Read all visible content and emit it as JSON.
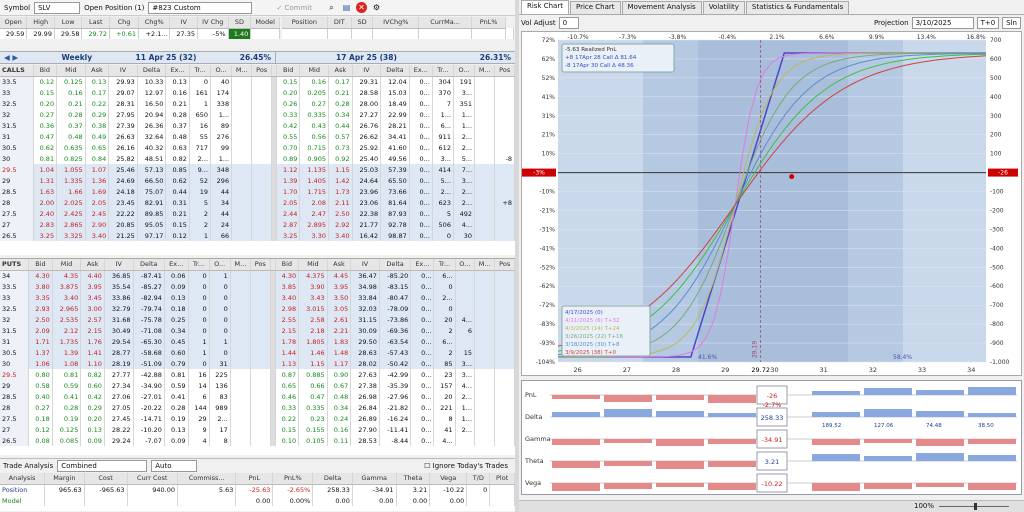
{
  "toolbar": {
    "symbol_label": "Symbol",
    "symbol_value": "SLV",
    "open_position_label": "Open Position (1)",
    "position_value": "#823 Custom",
    "commit_label": "Commit"
  },
  "quote": {
    "headers": [
      "Open",
      "High",
      "Low",
      "Last",
      "Chg",
      "Chg%",
      "IV",
      "IV Chg",
      "SD",
      "Model",
      "Position",
      "DIT",
      "SD",
      "IVChg%",
      "CurrMa...",
      "PnL%"
    ],
    "values": [
      "29.59",
      "29.99",
      "29.58",
      "29.72",
      "+0.61",
      "+2.1...",
      "27.35",
      "-5%",
      "1.40"
    ]
  },
  "weekly": {
    "left_label": "Weekly",
    "left_title": "11 Apr 25 (32)",
    "left_iv": "26.45%",
    "right_title": "17 Apr 25 (38)",
    "right_iv": "26.31%"
  },
  "calls_label": "CALLS",
  "puts_label": "PUTS",
  "left_cols": [
    "Bid",
    "Mid",
    "Ask",
    "IV",
    "Delta",
    "Ex...",
    "Tr...",
    "O...",
    "M...",
    "Pos"
  ],
  "right_cols": [
    "Bid",
    "Mid",
    "Ask",
    "IV",
    "Delta",
    "Ex...",
    "Tr...",
    "O...",
    "M...",
    "Pos"
  ],
  "calls": [
    {
      "s": "33.5",
      "l": [
        "0.12",
        "0.125",
        "0.13",
        "29.93",
        "10.33",
        "0.13",
        "0",
        "40",
        "",
        ""
      ],
      "r": [
        "0.15",
        "0.16",
        "0.17",
        "29.31",
        "12.04",
        "0...",
        "304",
        "191",
        "",
        ""
      ]
    },
    {
      "s": "33",
      "l": [
        "0.15",
        "0.16",
        "0.17",
        "29.07",
        "12.97",
        "0.16",
        "161",
        "174",
        "",
        ""
      ],
      "r": [
        "0.20",
        "0.205",
        "0.21",
        "28.58",
        "15.03",
        "0...",
        "370",
        "3...",
        "",
        ""
      ]
    },
    {
      "s": "32.5",
      "l": [
        "0.20",
        "0.21",
        "0.22",
        "28.31",
        "16.50",
        "0.21",
        "1",
        "338",
        "",
        ""
      ],
      "r": [
        "0.26",
        "0.27",
        "0.28",
        "28.00",
        "18.49",
        "0...",
        "7",
        "351",
        "",
        ""
      ]
    },
    {
      "s": "32",
      "l": [
        "0.27",
        "0.28",
        "0.29",
        "27.95",
        "20.94",
        "0.28",
        "650",
        "1...",
        "",
        ""
      ],
      "r": [
        "0.33",
        "0.335",
        "0.34",
        "27.27",
        "22.99",
        "0...",
        "1...",
        "1...",
        "",
        ""
      ]
    },
    {
      "s": "31.5",
      "l": [
        "0.36",
        "0.37",
        "0.38",
        "27.39",
        "26.36",
        "0.37",
        "16",
        "89",
        "",
        ""
      ],
      "r": [
        "0.42",
        "0.43",
        "0.44",
        "26.76",
        "28.21",
        "0...",
        "6...",
        "1...",
        "",
        ""
      ]
    },
    {
      "s": "31",
      "l": [
        "0.47",
        "0.48",
        "0.49",
        "26.63",
        "32.64",
        "0.48",
        "55",
        "276",
        "",
        ""
      ],
      "r": [
        "0.55",
        "0.56",
        "0.57",
        "26.62",
        "34.41",
        "0...",
        "911",
        "2...",
        "",
        ""
      ]
    },
    {
      "s": "30.5",
      "l": [
        "0.62",
        "0.635",
        "0.65",
        "26.16",
        "40.32",
        "0.63",
        "717",
        "99",
        "",
        ""
      ],
      "r": [
        "0.70",
        "0.715",
        "0.73",
        "25.92",
        "41.60",
        "0...",
        "612",
        "2...",
        "",
        ""
      ]
    },
    {
      "s": "30",
      "l": [
        "0.81",
        "0.825",
        "0.84",
        "25.82",
        "48.51",
        "0.82",
        "2...",
        "1...",
        "",
        ""
      ],
      "r": [
        "0.89",
        "0.905",
        "0.92",
        "25.40",
        "49.56",
        "0...",
        "3...",
        "5...",
        "",
        "-8"
      ]
    },
    {
      "s": "29.5",
      "l": [
        "1.04",
        "1.055",
        "1.07",
        "25.46",
        "57.13",
        "0.85",
        "9...",
        "348",
        "",
        ""
      ],
      "r": [
        "1.12",
        "1.135",
        "1.15",
        "25.03",
        "57.39",
        "0...",
        "414",
        "7...",
        "",
        ""
      ]
    },
    {
      "s": "29",
      "l": [
        "1.31",
        "1.335",
        "1.36",
        "24.69",
        "66.50",
        "0.62",
        "52",
        "296",
        "",
        ""
      ],
      "r": [
        "1.39",
        "1.405",
        "1.42",
        "24.64",
        "65.50",
        "0...",
        "5...",
        "3...",
        "",
        ""
      ]
    },
    {
      "s": "28.5",
      "l": [
        "1.63",
        "1.66",
        "1.69",
        "24.18",
        "75.07",
        "0.44",
        "19",
        "44",
        "",
        ""
      ],
      "r": [
        "1.70",
        "1.715",
        "1.73",
        "23.96",
        "73.66",
        "0...",
        "2...",
        "2...",
        "",
        ""
      ]
    },
    {
      "s": "28",
      "l": [
        "2.00",
        "2.025",
        "2.05",
        "23.45",
        "82.91",
        "0.31",
        "5",
        "34",
        "",
        ""
      ],
      "r": [
        "2.05",
        "2.08",
        "2.11",
        "23.06",
        "81.64",
        "0...",
        "623",
        "2...",
        "",
        "+8"
      ]
    },
    {
      "s": "27.5",
      "l": [
        "2.40",
        "2.425",
        "2.45",
        "22.22",
        "89.85",
        "0.21",
        "2",
        "44",
        "",
        ""
      ],
      "r": [
        "2.44",
        "2.47",
        "2.50",
        "22.38",
        "87.93",
        "0...",
        "5",
        "492",
        "",
        ""
      ]
    },
    {
      "s": "27",
      "l": [
        "2.83",
        "2.865",
        "2.90",
        "20.85",
        "95.05",
        "0.15",
        "2",
        "24",
        "",
        ""
      ],
      "r": [
        "2.87",
        "2.895",
        "2.92",
        "21.77",
        "92.78",
        "0...",
        "506",
        "4...",
        "",
        ""
      ]
    },
    {
      "s": "26.5",
      "l": [
        "3.25",
        "3.325",
        "3.40",
        "21.25",
        "97.17",
        "0.12",
        "1",
        "66",
        "",
        ""
      ],
      "r": [
        "3.25",
        "3.30",
        "3.40",
        "16.42",
        "98.87",
        "0...",
        "0",
        "30",
        "",
        ""
      ]
    }
  ],
  "puts": [
    {
      "s": "34",
      "l": [
        "4.30",
        "4.35",
        "4.40",
        "36.85",
        "-87.41",
        "0.06",
        "0",
        "1",
        "",
        ""
      ],
      "r": [
        "4.30",
        "4.375",
        "4.45",
        "36.47",
        "-85.20",
        "0...",
        "6...",
        "",
        "",
        ""
      ]
    },
    {
      "s": "33.5",
      "l": [
        "3.80",
        "3.875",
        "3.95",
        "35.54",
        "-85.27",
        "0.09",
        "0",
        "0",
        "",
        ""
      ],
      "r": [
        "3.85",
        "3.90",
        "3.95",
        "34.98",
        "-83.15",
        "0...",
        "0",
        "",
        "",
        ""
      ]
    },
    {
      "s": "33",
      "l": [
        "3.35",
        "3.40",
        "3.45",
        "33.86",
        "-82.94",
        "0.13",
        "0",
        "0",
        "",
        ""
      ],
      "r": [
        "3.40",
        "3.43",
        "3.50",
        "33.84",
        "-80.47",
        "0...",
        "2...",
        "",
        "",
        ""
      ]
    },
    {
      "s": "32.5",
      "l": [
        "2.93",
        "2.965",
        "3.00",
        "32.79",
        "-79.74",
        "0.18",
        "0",
        "0",
        "",
        ""
      ],
      "r": [
        "2.98",
        "3.015",
        "3.05",
        "32.03",
        "-78.09",
        "0...",
        "0",
        "",
        "",
        ""
      ]
    },
    {
      "s": "32",
      "l": [
        "2.50",
        "2.535",
        "2.57",
        "31.68",
        "-75.78",
        "0.25",
        "0",
        "0",
        "",
        ""
      ],
      "r": [
        "2.55",
        "2.58",
        "2.61",
        "31.15",
        "-73.86",
        "0...",
        "20",
        "4...",
        "",
        ""
      ]
    },
    {
      "s": "31.5",
      "l": [
        "2.09",
        "2.12",
        "2.15",
        "30.49",
        "-71.08",
        "0.34",
        "0",
        "0",
        "",
        ""
      ],
      "r": [
        "2.15",
        "2.18",
        "2.21",
        "30.09",
        "-69.36",
        "0...",
        "2",
        "6",
        "",
        ""
      ]
    },
    {
      "s": "31",
      "l": [
        "1.71",
        "1.735",
        "1.76",
        "29.54",
        "-65.30",
        "0.45",
        "1",
        "1",
        "",
        ""
      ],
      "r": [
        "1.78",
        "1.805",
        "1.83",
        "29.50",
        "-63.54",
        "0...",
        "6...",
        "",
        "",
        ""
      ]
    },
    {
      "s": "30.5",
      "l": [
        "1.37",
        "1.39",
        "1.41",
        "28.77",
        "-58.68",
        "0.60",
        "1",
        "0",
        "",
        ""
      ],
      "r": [
        "1.44",
        "1.46",
        "1.48",
        "28.63",
        "-57.43",
        "0...",
        "2",
        "15",
        "",
        ""
      ]
    },
    {
      "s": "30",
      "l": [
        "1.06",
        "1.08",
        "1.10",
        "28.19",
        "-51.09",
        "0.79",
        "0",
        "31",
        "",
        ""
      ],
      "r": [
        "1.13",
        "1.15",
        "1.17",
        "28.02",
        "-50.42",
        "0...",
        "85",
        "3...",
        "",
        ""
      ]
    },
    {
      "s": "29.5",
      "l": [
        "0.80",
        "0.81",
        "0.82",
        "27.77",
        "-42.88",
        "0.81",
        "16",
        "225",
        "",
        ""
      ],
      "r": [
        "0.87",
        "0.885",
        "0.90",
        "27.63",
        "-42.99",
        "0...",
        "23",
        "3...",
        "",
        ""
      ]
    },
    {
      "s": "29",
      "l": [
        "0.58",
        "0.59",
        "0.60",
        "27.34",
        "-34.90",
        "0.59",
        "14",
        "136",
        "",
        ""
      ],
      "r": [
        "0.65",
        "0.66",
        "0.67",
        "27.38",
        "-35.39",
        "0...",
        "157",
        "4...",
        "",
        ""
      ]
    },
    {
      "s": "28.5",
      "l": [
        "0.40",
        "0.41",
        "0.42",
        "27.06",
        "-27.01",
        "0.41",
        "6",
        "83",
        "",
        ""
      ],
      "r": [
        "0.46",
        "0.47",
        "0.48",
        "26.98",
        "-27.96",
        "0...",
        "20",
        "2...",
        "",
        ""
      ]
    },
    {
      "s": "28",
      "l": [
        "0.27",
        "0.28",
        "0.29",
        "27.05",
        "-20.22",
        "0.28",
        "144",
        "989",
        "",
        ""
      ],
      "r": [
        "0.33",
        "0.335",
        "0.34",
        "26.84",
        "-21.82",
        "0...",
        "221",
        "1...",
        "",
        ""
      ]
    },
    {
      "s": "27.5",
      "l": [
        "0.18",
        "0.19",
        "0.20",
        "27.45",
        "-14.71",
        "0.19",
        "29",
        "2...",
        "",
        ""
      ],
      "r": [
        "0.22",
        "0.23",
        "0.24",
        "26.89",
        "-16.24",
        "0...",
        "8",
        "1...",
        "",
        ""
      ]
    },
    {
      "s": "27",
      "l": [
        "0.12",
        "0.125",
        "0.13",
        "28.22",
        "-10.20",
        "0.13",
        "9",
        "17",
        "",
        ""
      ],
      "r": [
        "0.15",
        "0.155",
        "0.16",
        "27.90",
        "-11.41",
        "0...",
        "41",
        "2...",
        "",
        ""
      ]
    },
    {
      "s": "26.5",
      "l": [
        "0.08",
        "0.085",
        "0.09",
        "29.24",
        "-7.07",
        "0.09",
        "4",
        "8",
        "",
        ""
      ],
      "r": [
        "0.10",
        "0.105",
        "0.11",
        "28.53",
        "-8.44",
        "0...",
        "4...",
        "",
        "",
        ""
      ]
    }
  ],
  "analysis": {
    "label": "Trade Analysis",
    "combined": "Combined",
    "auto": "Auto",
    "ignore": "Ignore Today's Trades",
    "cols": [
      "Analysis",
      "Margin",
      "Cost",
      "Curr Cost",
      "Commiss...",
      "PnL",
      "PnL%",
      "Delta",
      "Gamma",
      "Theta",
      "Vega",
      "T/D",
      "Plot"
    ],
    "position": [
      "Position",
      "965.63",
      "-965.63",
      "940.00",
      "5.63",
      "-25.63",
      "-2.65%",
      "258.33",
      "-34.91",
      "3.21",
      "-10.22",
      "0",
      ""
    ],
    "model": [
      "Model",
      "",
      "",
      "",
      "",
      "0.00",
      "0.00%",
      "0.00",
      "0.00",
      "0.00",
      "0.00",
      "",
      ""
    ]
  },
  "right": {
    "tabs": [
      "Risk Chart",
      "Price Chart",
      "Movement Analysis",
      "Volatility",
      "Statistics & Fundamentals"
    ],
    "vol_adjust_label": "Vol Adjust",
    "vol_adjust_value": "0",
    "projection_label": "Projection",
    "projection_value": "3/10/2025",
    "t0": "T+0",
    "sln": "Sln",
    "legend": [
      "-5.63 Realized PnL",
      "+8 17Apr 28 Call Δ   81.64",
      "-8 17Apr 30 Call Δ   48.36"
    ],
    "lower_legend": [
      "4/17/2025 (0)",
      "4/11/2025 (6) T+32",
      "4/3/2025 (14) T+24",
      "3/26/2025 (22) T+16",
      "3/18/2025 (30) T+8",
      "3/9/2025 (38) T+0"
    ],
    "top_ticks": [
      "-10.7%",
      "-7.3%",
      "-3.8%",
      "-0.4%",
      "2.1%",
      "6.6%",
      "9.9%",
      "13.4%",
      "16.8%"
    ],
    "left_ticks": [
      "72%",
      "62%",
      "52%",
      "41%",
      "31%",
      "21%",
      "10%",
      "0%",
      "-10%",
      "-21%",
      "-31%",
      "-41%",
      "-52%",
      "-62%",
      "-72%",
      "-83%",
      "-93%",
      "-104%"
    ],
    "right_ticks": [
      "700",
      "600",
      "500",
      "400",
      "300",
      "200",
      "100",
      "0",
      "-100",
      "-200",
      "-300",
      "-400",
      "-500",
      "-600",
      "-700",
      "-800",
      "-900",
      "-1,000"
    ],
    "bottom_ticks": [
      "26",
      "27",
      "28",
      "29",
      "29.72",
      "30",
      "31",
      "32",
      "33",
      "34"
    ],
    "zero_left": "-3%",
    "zero_right": "-26",
    "pct_left": "41.6%",
    "pct_right": "58.4%",
    "price_label": "29.19",
    "greek_labels": [
      "PnL",
      "Delta",
      "Gamma",
      "Theta",
      "Vega"
    ],
    "greek_center": [
      "-26",
      "258.33",
      "-34.91",
      "3.21",
      "-10.22"
    ],
    "greek_pnl_pct": "-2.7%",
    "greek_pos": [
      "189.52",
      "127.06",
      "74.48",
      "38.50"
    ],
    "status_zoom": "100%"
  }
}
